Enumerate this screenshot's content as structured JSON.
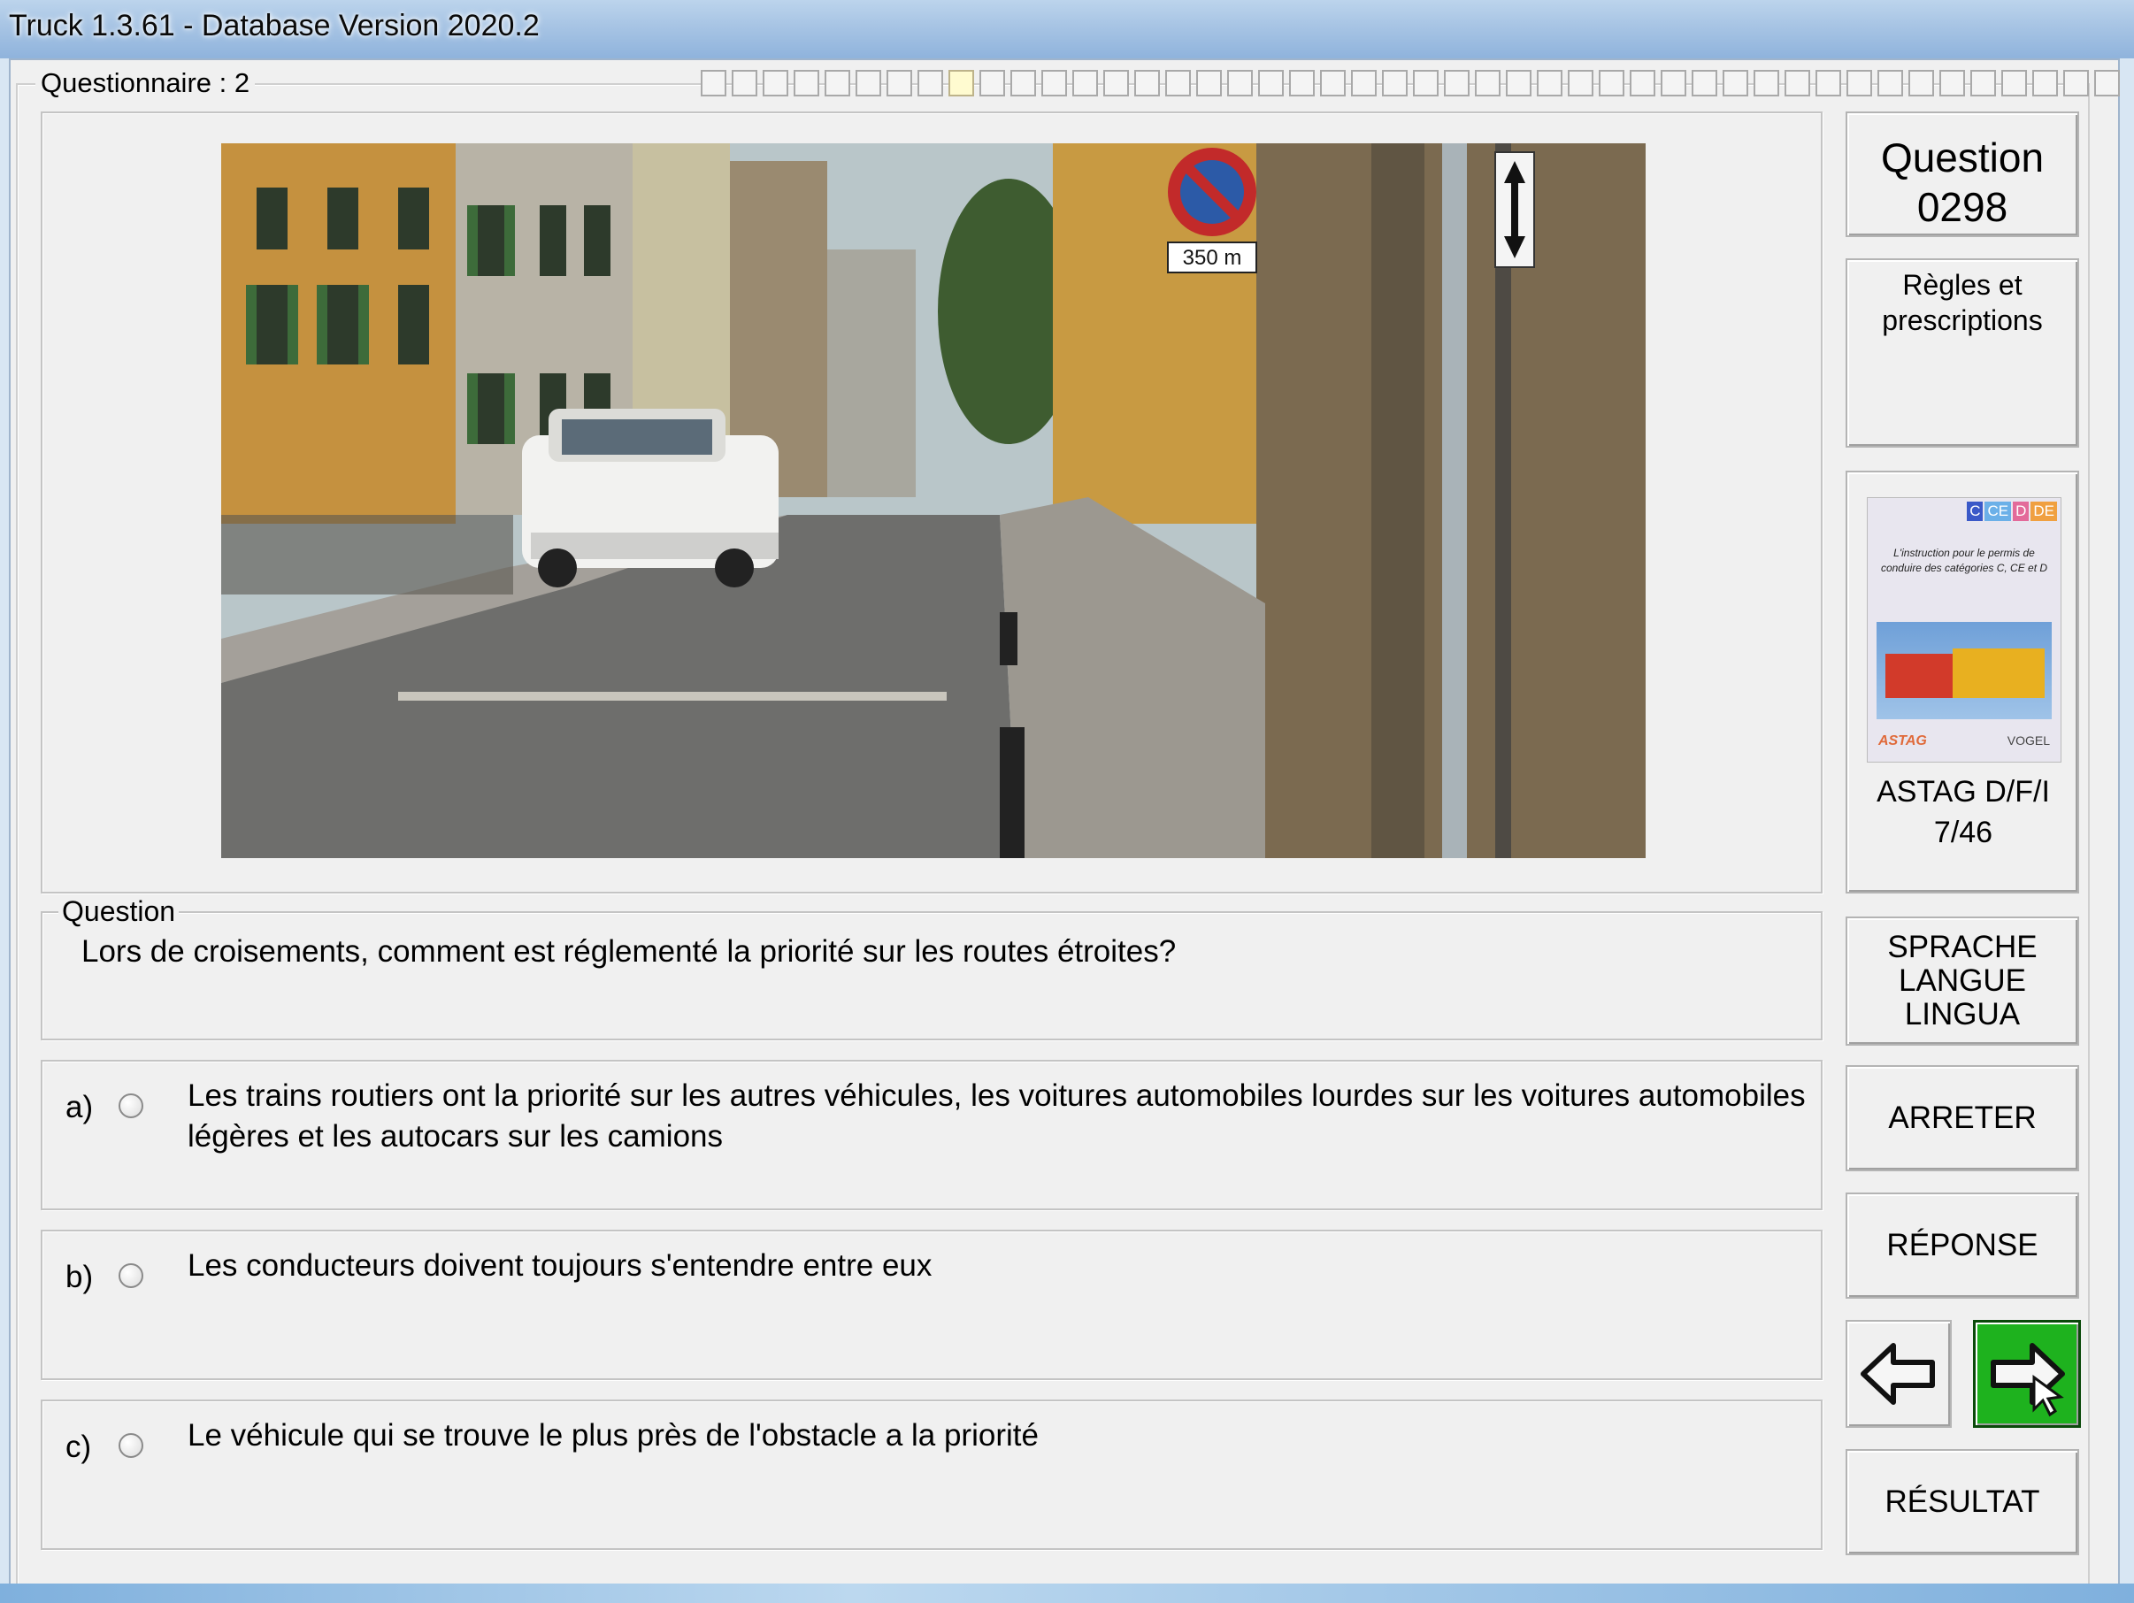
{
  "window": {
    "title": "Truck 1.3.61 - Database Version 2020.2"
  },
  "quiz": {
    "label": "Questionnaire : 2",
    "progress_total": 46,
    "progress_current": 9
  },
  "question": {
    "legend": "Question",
    "text": "Lors de croisements, comment est réglementé la priorité sur les routes étroites?"
  },
  "answers": [
    {
      "letter": "a)",
      "text": "Les trains routiers ont la priorité sur les autres véhicules, les voitures automobiles lourdes sur les voitures automobiles légères et les autocars sur les camions"
    },
    {
      "letter": "b)",
      "text": "Les conducteurs doivent toujours s'entendre entre eux"
    },
    {
      "letter": "c)",
      "text": "Le véhicule qui se trouve le plus près de l'obstacle a la priorité"
    }
  ],
  "sidebar": {
    "question_label": "Question",
    "question_number": "0298",
    "category_line1": "Règles et",
    "category_line2": "prescriptions",
    "book_badges": [
      "C",
      "CE",
      "D",
      "DE"
    ],
    "book_text": "L'instruction pour le permis de conduire des catégories C, CE et D",
    "book_logo_left": "ASTAG",
    "book_logo_right": "VOGEL",
    "source_line1": "ASTAG D/F/I",
    "source_line2": "7/46",
    "lang_line1": "SPRACHE",
    "lang_line2": "LANGUE",
    "lang_line3": "LINGUA",
    "stop_label": "ARRETER",
    "answer_label": "RÉPONSE",
    "result_label": "RÉSULTAT",
    "prev_icon": "arrow-left-icon",
    "next_icon": "arrow-right-icon"
  },
  "photo": {
    "sign_text": "350 m"
  },
  "colors": {
    "next_button": "#1eb21e",
    "titlebar": "#a7c4e4"
  }
}
